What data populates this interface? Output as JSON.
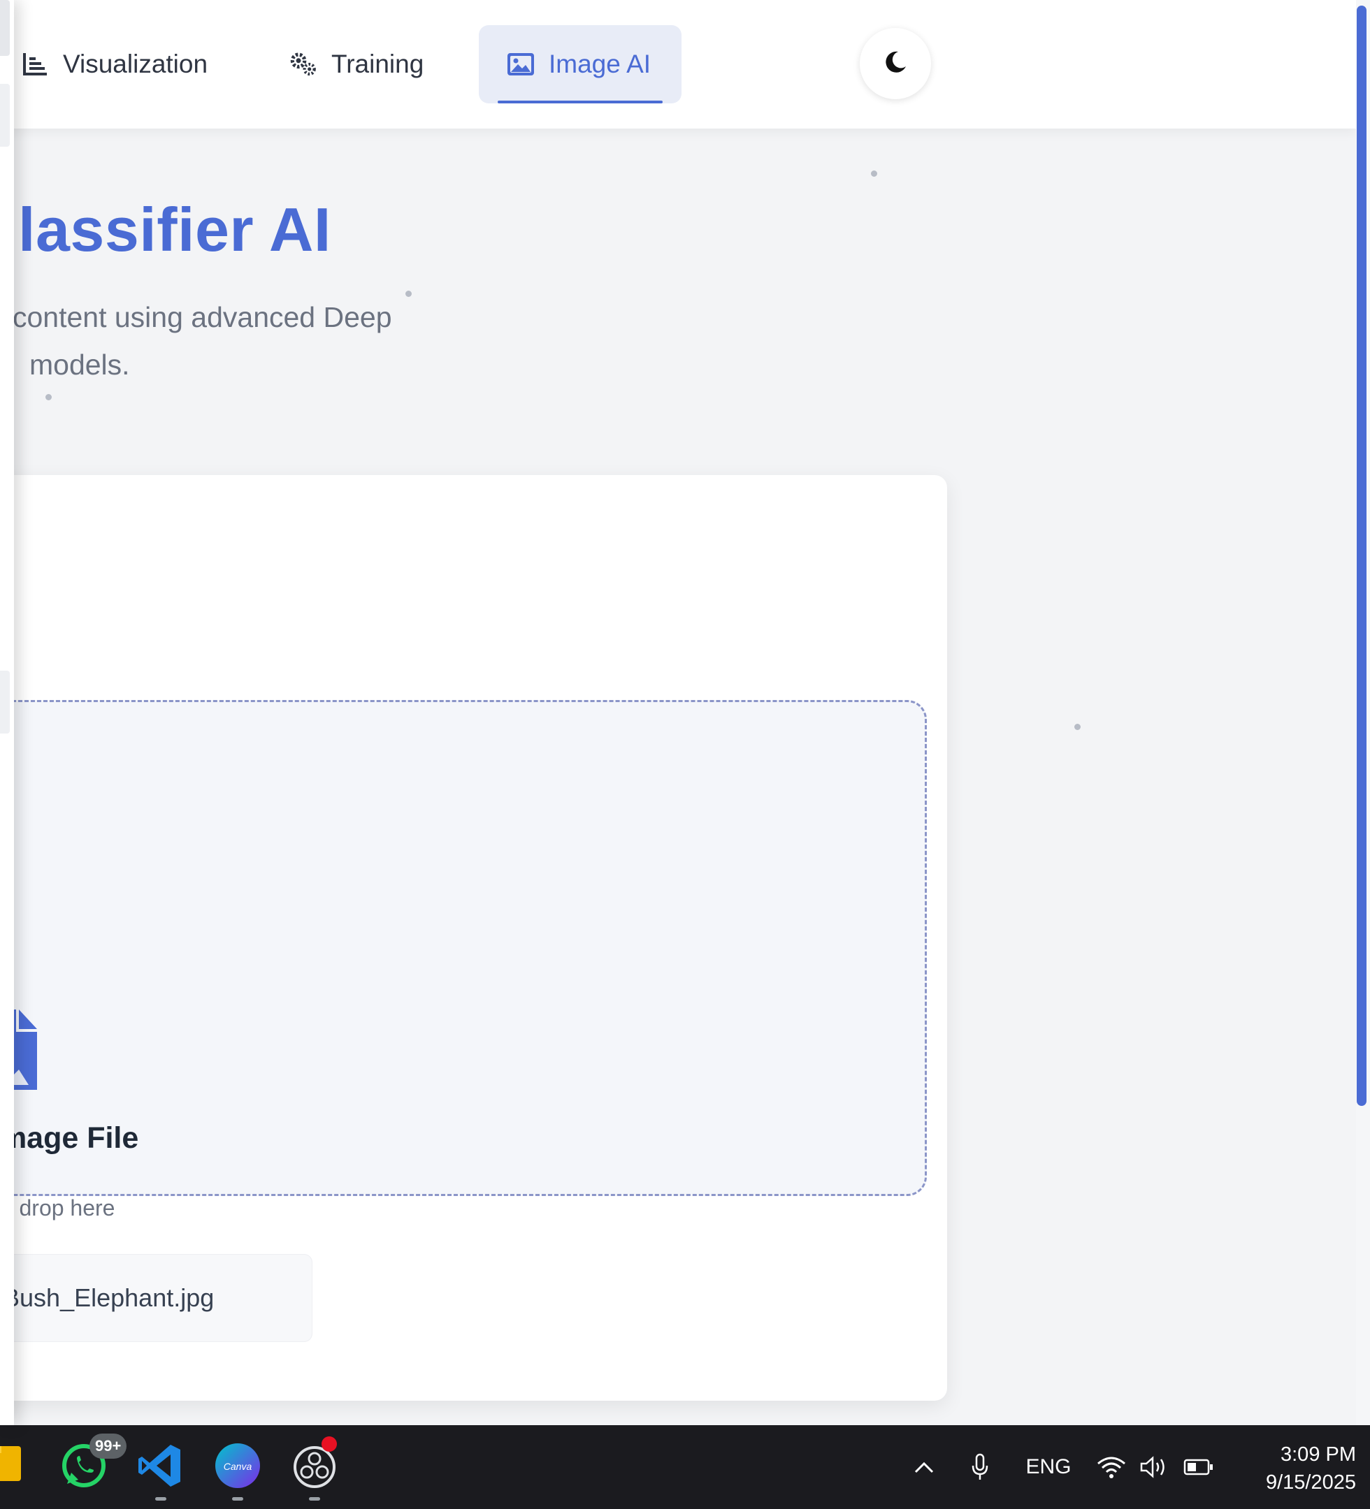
{
  "nav": {
    "tabs": [
      {
        "label": "Visualization",
        "icon": "chart-icon"
      },
      {
        "label": "Training",
        "icon": "gears-icon"
      },
      {
        "label": "Image AI",
        "icon": "image-icon",
        "active": true
      }
    ],
    "theme_toggle_icon": "moon-icon"
  },
  "hero": {
    "title": "lassifier AI",
    "subtitle_line1": "content using advanced Deep",
    "subtitle_line2": "models."
  },
  "upload": {
    "icon": "file-image-icon",
    "title": "Image File",
    "hint": "nd drop here",
    "file_name": "_Bush_Elephant.jpg"
  },
  "taskbar": {
    "apps": [
      {
        "name": "file-explorer"
      },
      {
        "name": "whatsapp",
        "badge": "99+"
      },
      {
        "name": "vscode"
      },
      {
        "name": "canva",
        "label": "Canva"
      },
      {
        "name": "obs"
      }
    ],
    "tray": {
      "language": "ENG",
      "time": "3:09 PM",
      "date": "9/15/2025"
    }
  },
  "colors": {
    "accent": "#4a6bd4",
    "background": "#f3f4f6",
    "taskbar": "#1b1b1f"
  }
}
